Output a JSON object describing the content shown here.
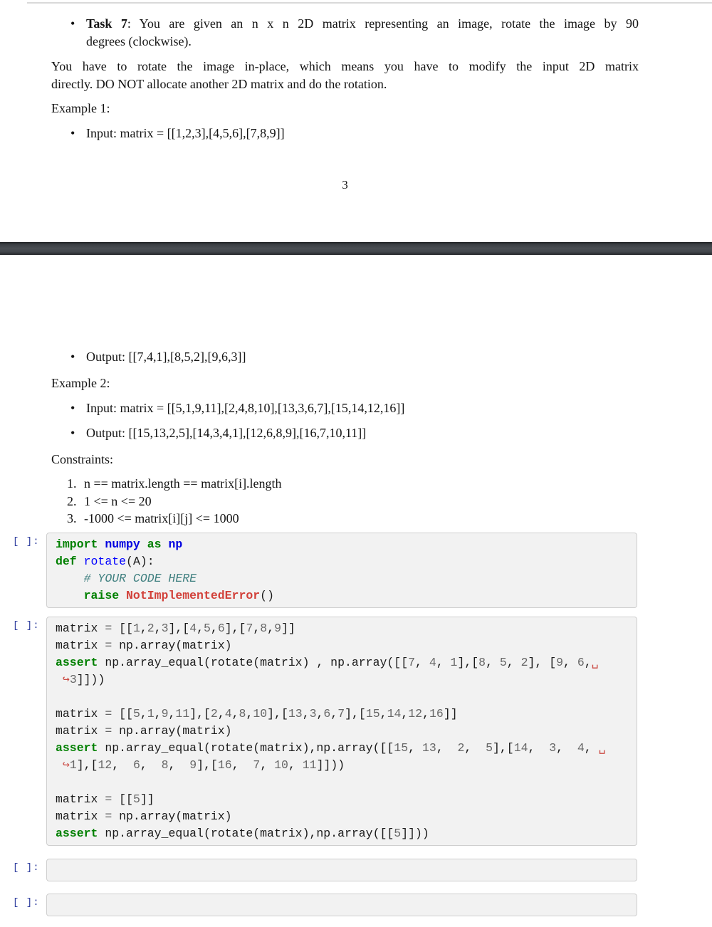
{
  "bullet_glyph": "•",
  "colors": {
    "prompt": "#303F9F",
    "keyword": "#008000",
    "namespace": "#0000E0",
    "function_name": "#0000FF",
    "comment": "#408080",
    "exception": "#D2413A",
    "number": "#666666",
    "operator": "#666666",
    "wrap_marker": "#CB4B44",
    "cell_background": "#F2F2F2",
    "cell_border": "#CFCFCF",
    "separator_bar": "#3F4348",
    "top_rule": "#D9D9D9"
  },
  "document": {
    "page1": {
      "task_item": {
        "label": "Task 7",
        "line1_rest": ": You are given an n x n 2D matrix representing an image, rotate the image by 90",
        "line2": "degrees (clockwise)."
      },
      "paragraph_line1": "You have to rotate the image in-place, which means you have to modify the input 2D matrix",
      "paragraph_line2": "directly. DO NOT allocate another 2D matrix and do the rotation.",
      "example1_heading": "Example 1:",
      "example1_input": "Input: matrix = [[1,2,3],[4,5,6],[7,8,9]]",
      "page_number": "3"
    },
    "page2": {
      "example1_output": "Output: [[7,4,1],[8,5,2],[9,6,3]]",
      "example2_heading": "Example 2:",
      "example2_input": "Input: matrix = [[5,1,9,11],[2,4,8,10],[13,3,6,7],[15,14,12,16]]",
      "example2_output": "Output: [[15,13,2,5],[14,3,4,1],[12,6,8,9],[16,7,10,11]]",
      "constraints_heading": "Constraints:",
      "constraints": [
        {
          "num": "1.",
          "text": "n == matrix.length == matrix[i].length"
        },
        {
          "num": "2.",
          "text": "1 <= n <= 20"
        },
        {
          "num": "3.",
          "text": "-1000 <= matrix[i][j] <= 1000"
        }
      ]
    }
  },
  "cells": [
    {
      "prompt": "[ ]:",
      "lines": [
        "import numpy as np",
        "def rotate(A):",
        "    # YOUR CODE HERE",
        "    raise NotImplementedError()"
      ]
    },
    {
      "prompt": "[ ]:",
      "lines": [
        "matrix = [[1,2,3],[4,5,6],[7,8,9]]",
        "matrix = np.array(matrix)",
        "assert np.array_equal(rotate(matrix) , np.array([[7, 4, 1],[8, 5, 2], [9, 6,␣",
        " ↪3]]))",
        "",
        "matrix = [[5,1,9,11],[2,4,8,10],[13,3,6,7],[15,14,12,16]]",
        "matrix = np.array(matrix)",
        "assert np.array_equal(rotate(matrix),np.array([[15, 13,  2,  5],[14,  3,  4, ␣",
        " ↪1],[12,  6,  8,  9],[16,  7, 10, 11]]))",
        "",
        "matrix = [[5]]",
        "matrix = np.array(matrix)",
        "assert np.array_equal(rotate(matrix),np.array([[5]]))"
      ]
    },
    {
      "prompt": "[ ]:",
      "lines": []
    },
    {
      "prompt": "[ ]:",
      "lines": []
    }
  ]
}
